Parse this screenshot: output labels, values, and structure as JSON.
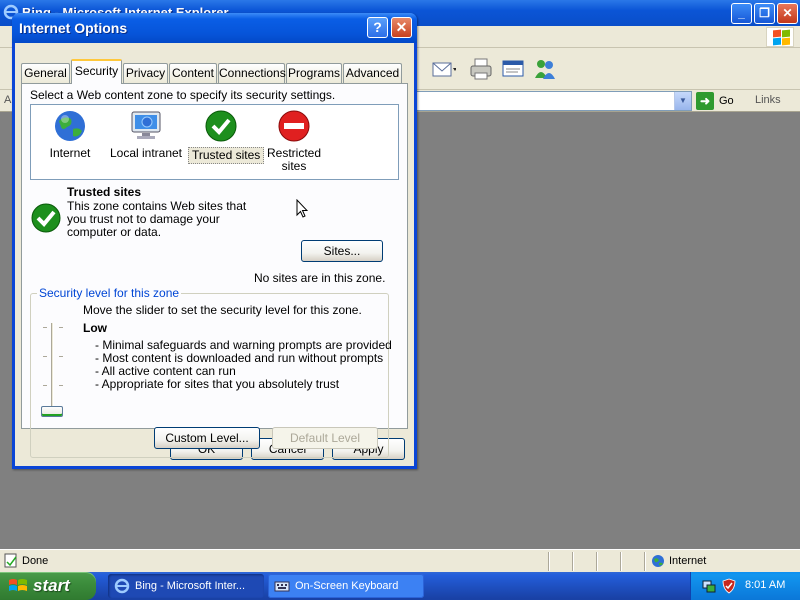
{
  "ie": {
    "title": "Bing - Microsoft Internet Explorer",
    "address_label": "A",
    "go_label": "Go",
    "links_label": "Links",
    "status_text": "Done",
    "zone_text": "Internet"
  },
  "dialog": {
    "title": "Internet Options",
    "help_label": "?",
    "close_label": "✕",
    "tabs": [
      {
        "label": "General"
      },
      {
        "label": "Security"
      },
      {
        "label": "Privacy"
      },
      {
        "label": "Content"
      },
      {
        "label": "Connections"
      },
      {
        "label": "Programs"
      },
      {
        "label": "Advanced"
      }
    ],
    "selected_tab": "Security",
    "zone_instruction": "Select a Web content zone to specify its security settings.",
    "zones": [
      {
        "label": "Internet",
        "icon": "globe-icon"
      },
      {
        "label": "Local intranet",
        "icon": "computer-icon"
      },
      {
        "label": "Trusted sites",
        "icon": "green-check-icon"
      },
      {
        "label": "Restricted sites",
        "icon": "red-no-entry-icon"
      }
    ],
    "selected_zone": "Trusted sites",
    "zone_heading": "Trusted sites",
    "zone_description": "This zone contains Web sites that you trust not to damage your computer or data.",
    "sites_button": "Sites...",
    "sites_note": "No sites are in this zone.",
    "security_group_label": "Security level for this zone",
    "slider_instruction": "Move the slider to set the security level for this zone.",
    "level_name": "Low",
    "level_bullets": [
      "- Minimal safeguards and warning prompts are provided",
      "- Most content is downloaded and run without prompts",
      "- All active content can run",
      "- Appropriate for sites that you absolutely trust"
    ],
    "slider_level": "Low (lowest of 4 positions)",
    "custom_level_button": "Custom Level...",
    "default_level_button": "Default Level",
    "ok_button": "OK",
    "cancel_button": "Cancel",
    "apply_button": "Apply"
  },
  "taskbar": {
    "start_label": "start",
    "tasks": [
      {
        "label": "Bing - Microsoft Inter...",
        "active": true
      },
      {
        "label": "On-Screen Keyboard",
        "active": false
      }
    ],
    "clock": "8:01 AM"
  },
  "colors": {
    "titlebar_blue": "#0a5ee6",
    "taskbar_blue": "#245edb",
    "start_green": "#3c8d3c",
    "dialog_face": "#ece9d8",
    "group_label_blue": "#0046d5"
  }
}
